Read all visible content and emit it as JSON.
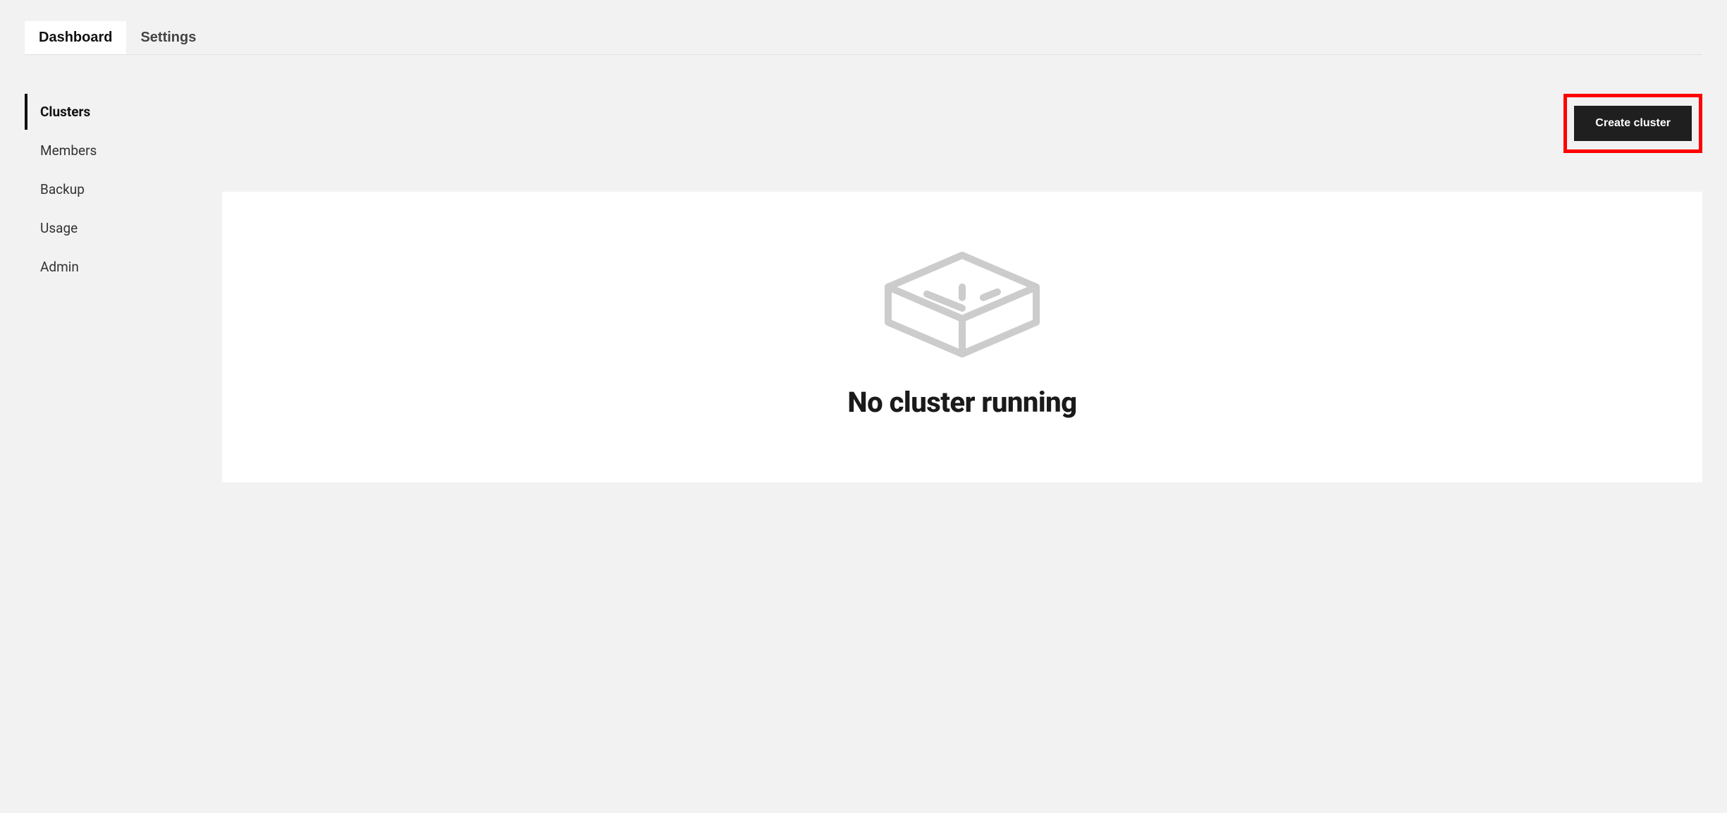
{
  "tabs": [
    {
      "label": "Dashboard",
      "active": true
    },
    {
      "label": "Settings",
      "active": false
    }
  ],
  "sidebar": {
    "items": [
      {
        "label": "Clusters",
        "active": true
      },
      {
        "label": "Members",
        "active": false
      },
      {
        "label": "Backup",
        "active": false
      },
      {
        "label": "Usage",
        "active": false
      },
      {
        "label": "Admin",
        "active": false
      }
    ]
  },
  "actions": {
    "create_cluster_label": "Create cluster",
    "highlighted": true
  },
  "empty_state": {
    "title": "No cluster running",
    "icon": "empty-box-icon"
  },
  "colors": {
    "page_bg": "#f2f2f2",
    "card_bg": "#ffffff",
    "button_bg": "#1f1f1f",
    "button_text": "#ffffff",
    "highlight_border": "#ff0000",
    "text_primary": "#111111",
    "text_secondary": "#444444",
    "icon_stroke": "#cccccc"
  }
}
